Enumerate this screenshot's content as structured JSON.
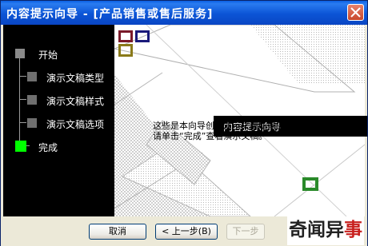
{
  "window": {
    "title": "内容提示向导 - [产品销售或售后服务]"
  },
  "steps": [
    {
      "label": "开始",
      "state": "done"
    },
    {
      "label": "演示文稿类型",
      "state": "pending"
    },
    {
      "label": "演示文稿样式",
      "state": "pending"
    },
    {
      "label": "演示文稿选项",
      "state": "pending"
    },
    {
      "label": "完成",
      "state": "current"
    }
  ],
  "content": {
    "heading": "内容提示向导",
    "line1": "这些是本向导创建演示文稿所需的答案。",
    "line2": "请单击“完成”查看演示文稿。"
  },
  "buttons": {
    "cancel": "取消",
    "back": "< 上一步(B)",
    "next": "下一步"
  },
  "watermark": {
    "part1": "奇闻异",
    "part2": "事"
  },
  "colors": {
    "title": "#0a54d6",
    "current_step": "#00ff00",
    "pending_step": "#808080",
    "accent_green": "#2a8a2a",
    "accent_navy": "#1a1a7a",
    "accent_maroon": "#7a1a2a",
    "accent_olive": "#8a7a1a"
  }
}
